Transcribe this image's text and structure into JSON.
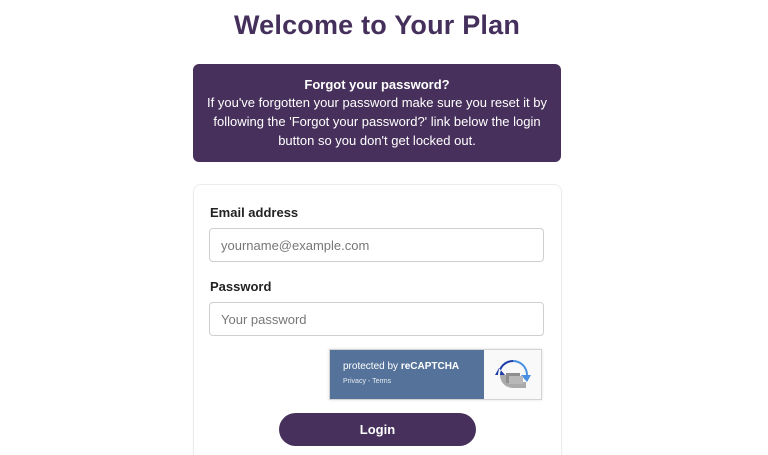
{
  "header": {
    "title": "Welcome to Your Plan"
  },
  "notice": {
    "title": "Forgot your password?",
    "body": "If you've forgotten your password make sure you reset it by following the 'Forgot your password?' link below the login button so you don't get locked out."
  },
  "form": {
    "email": {
      "label": "Email address",
      "placeholder": "yourname@example.com",
      "value": ""
    },
    "password": {
      "label": "Password",
      "placeholder": "Your password",
      "value": ""
    },
    "recaptcha": {
      "protected_text": "protected by ",
      "brand": "reCAPTCHA",
      "privacy": "Privacy",
      "separator": " - ",
      "terms": "Terms",
      "icon": "recaptcha-icon"
    },
    "login_label": "Login"
  },
  "colors": {
    "brand": "#47305b",
    "recaptcha_blue": "#55739a"
  }
}
